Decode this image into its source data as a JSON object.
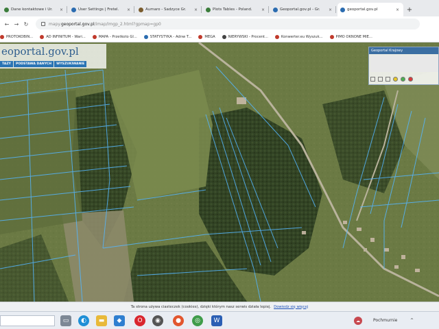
{
  "browser": {
    "tabs": [
      {
        "label": "Dane kontaktowe i Ur.",
        "active": false,
        "favicon_color": "#3b7d3b"
      },
      {
        "label": "User Settings | Fretel.",
        "active": false,
        "favicon_color": "#2b6cb0"
      },
      {
        "label": "Aumaro - Sadzyce Gr.",
        "active": false,
        "favicon_color": "#7a5c2e"
      },
      {
        "label": "Plots Tables - Poland.",
        "active": false,
        "favicon_color": "#3b7d3b"
      },
      {
        "label": "Geoportal.gov.pl - Gr.",
        "active": false,
        "favicon_color": "#2b6cb0"
      },
      {
        "label": "geoportal.gov.pl",
        "active": true,
        "favicon_color": "#2b6cb0"
      }
    ],
    "tab_close_glyph": "×",
    "new_tab_glyph": "+",
    "url": {
      "scheme": "mapy.",
      "host": "geoportal.gov.pl",
      "path": "/imap/Imgp_2.html?gpmap=gp0"
    },
    "bookmarks": [
      {
        "label": "PROTOKOBIN...",
        "color": "#c0392b"
      },
      {
        "label": "AD INFINITUM - Wari...",
        "color": "#c0392b"
      },
      {
        "label": "MAPA - Przetkoto Gl...",
        "color": "#c0392b"
      },
      {
        "label": "STATYSTYKA - Adnw T...",
        "color": "#2b6cb0"
      },
      {
        "label": "MEGA",
        "color": "#c0392b"
      },
      {
        "label": "NIERYWSKI - Procent...",
        "color": "#444444"
      },
      {
        "label": "Konwerter.eu Wyszuk...",
        "color": "#c0392b"
      },
      {
        "label": "PIMO OKNONE MIE...",
        "color": "#c0392b"
      }
    ]
  },
  "geoportal": {
    "logo_text": "eoportal.gov.pl",
    "menu": [
      "TAZY",
      "PODSTAWA DANYCH",
      "WYSZUKIWANIE"
    ],
    "panel_title": "Geoportal Krajowy"
  },
  "cookie": {
    "text": "Ta strona używa ciasteczek (cookies), dzięki którym nasz serwis działa lepiej.",
    "link": "Dowiedz się więcej"
  },
  "taskbar": {
    "weather": "Pochmurnie"
  }
}
